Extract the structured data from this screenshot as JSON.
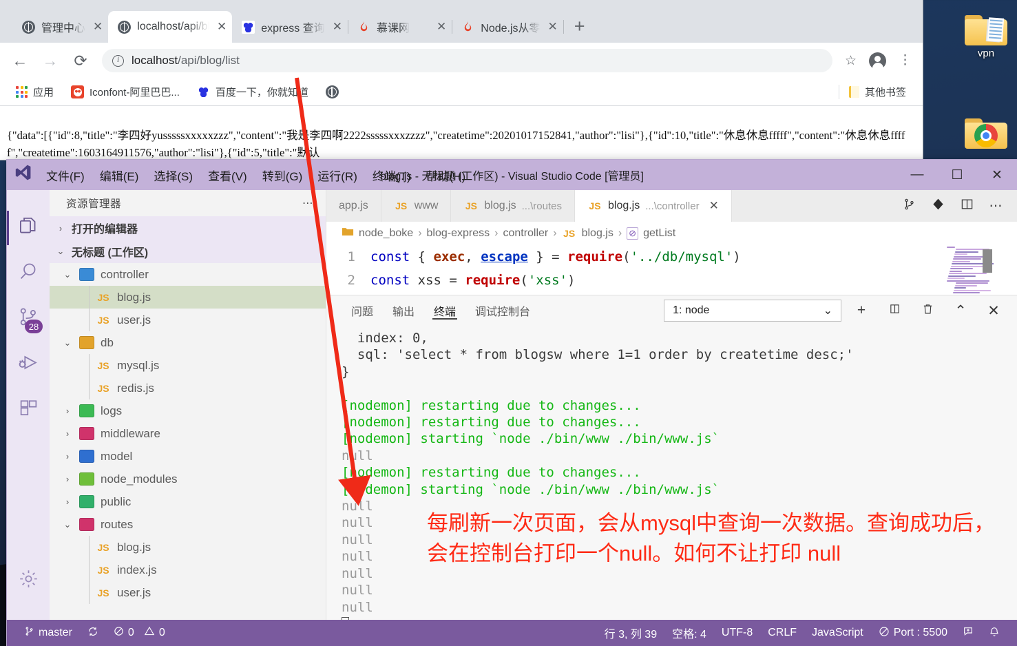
{
  "desktop": {
    "icons": [
      {
        "name": "vpn",
        "label": "vpn",
        "type": "folder"
      },
      {
        "name": "chrome-folder",
        "label": "",
        "type": "chrome-folder"
      }
    ]
  },
  "browser": {
    "tabs": [
      {
        "title": "管理中心",
        "favicon": "globe-icon",
        "active": false
      },
      {
        "title": "localhost/api/blog/list",
        "favicon": "globe-icon",
        "active": true
      },
      {
        "title": "express 查询",
        "favicon": "baidu-icon",
        "active": false
      },
      {
        "title": "慕课网",
        "favicon": "flame-icon",
        "active": false
      },
      {
        "title": "Node.js从零",
        "favicon": "flame-icon",
        "active": false
      }
    ],
    "new_tab_label": "+",
    "close_label": "✕",
    "nav": {
      "back": "←",
      "forward": "→",
      "reload": "⟳"
    },
    "url_prefix": "localhost",
    "url_path": "/api/blog/list",
    "star_label": "☆",
    "menu_label": "⋮",
    "bookmarks": [
      {
        "label": "应用",
        "icon": "apps-grid-icon"
      },
      {
        "label": "Iconfont-阿里巴巴...",
        "icon": "iconfont-icon"
      },
      {
        "label": "百度一下，你就知道",
        "icon": "baidu-icon"
      },
      {
        "label": "",
        "icon": "globe-icon"
      }
    ],
    "other_bookmarks": {
      "label": "其他书签",
      "icon": "folder-icon"
    },
    "page_body": "{\"data\":[{\"id\":8,\"title\":\"李四好yusssssxxxxxzzz\",\"content\":\"我是李四啊2222sssssxxxzzzz\",\"createtime\":20201017152841,\"author\":\"lisi\"},{\"id\":10,\"title\":\"休息休息fffff\",\"content\":\"休息休息fffff\",\"createtime\":1603164911576,\"author\":\"lisi\"},{\"id\":5,\"title\":\"默认"
  },
  "vscode": {
    "logo": "vscode-logo-icon",
    "menus": [
      "文件(F)",
      "编辑(E)",
      "选择(S)",
      "查看(V)",
      "转到(G)",
      "运行(R)",
      "终端(T)",
      "帮助(H)"
    ],
    "title": "blog.js - 无标题 (工作区) - Visual Studio Code [管理员]",
    "window_buttons": {
      "minimize": "—",
      "maximize": "☐",
      "close": "✕"
    },
    "activitybar": [
      {
        "name": "explorer",
        "icon": "files-icon",
        "selected": true,
        "badge": ""
      },
      {
        "name": "search",
        "icon": "search-icon",
        "selected": false,
        "badge": ""
      },
      {
        "name": "source-control",
        "icon": "source-control-icon",
        "selected": false,
        "badge": "28"
      },
      {
        "name": "run-debug",
        "icon": "run-debug-icon",
        "selected": false,
        "badge": ""
      },
      {
        "name": "extensions",
        "icon": "extensions-icon",
        "selected": false,
        "badge": ""
      },
      {
        "name": "settings",
        "icon": "gear-icon",
        "selected": false,
        "badge": ""
      }
    ],
    "sidebar": {
      "title": "资源管理器",
      "more_label": "⋯",
      "sections": [
        {
          "label": "打开的编辑器",
          "expanded": false,
          "chevron": "›"
        },
        {
          "label": "无标题 (工作区)",
          "expanded": true,
          "chevron": "⌄"
        }
      ],
      "tree": [
        {
          "label": "controller",
          "type": "folder",
          "indent": 1,
          "expanded": true,
          "chevron": "⌄",
          "color": "#3a8bd6",
          "selected": false
        },
        {
          "label": "blog.js",
          "type": "js",
          "indent": 2,
          "expanded": null,
          "chevron": "",
          "color": "",
          "selected": true
        },
        {
          "label": "user.js",
          "type": "js",
          "indent": 2,
          "expanded": null,
          "chevron": "",
          "color": "",
          "selected": false
        },
        {
          "label": "db",
          "type": "folder",
          "indent": 1,
          "expanded": true,
          "chevron": "⌄",
          "color": "#e2a32b",
          "selected": false
        },
        {
          "label": "mysql.js",
          "type": "js",
          "indent": 2,
          "expanded": null,
          "chevron": "",
          "color": "",
          "selected": false
        },
        {
          "label": "redis.js",
          "type": "js",
          "indent": 2,
          "expanded": null,
          "chevron": "",
          "color": "",
          "selected": false
        },
        {
          "label": "logs",
          "type": "folder",
          "indent": 1,
          "expanded": false,
          "chevron": "›",
          "color": "#3cba54",
          "selected": false
        },
        {
          "label": "middleware",
          "type": "folder",
          "indent": 1,
          "expanded": false,
          "chevron": "›",
          "color": "#d0336b",
          "selected": false
        },
        {
          "label": "model",
          "type": "folder",
          "indent": 1,
          "expanded": false,
          "chevron": "›",
          "color": "#2f6fd0",
          "selected": false
        },
        {
          "label": "node_modules",
          "type": "folder",
          "indent": 1,
          "expanded": false,
          "chevron": "›",
          "color": "#6fbf3a",
          "selected": false
        },
        {
          "label": "public",
          "type": "folder",
          "indent": 1,
          "expanded": false,
          "chevron": "›",
          "color": "#31b06a",
          "selected": false
        },
        {
          "label": "routes",
          "type": "folder",
          "indent": 1,
          "expanded": true,
          "chevron": "⌄",
          "color": "#d0336b",
          "selected": false
        },
        {
          "label": "blog.js",
          "type": "js",
          "indent": 2,
          "expanded": null,
          "chevron": "",
          "color": "",
          "selected": false
        },
        {
          "label": "index.js",
          "type": "js",
          "indent": 2,
          "expanded": null,
          "chevron": "",
          "color": "",
          "selected": false
        },
        {
          "label": "user.js",
          "type": "js",
          "indent": 2,
          "expanded": null,
          "chevron": "",
          "color": "",
          "selected": false
        }
      ]
    },
    "editor_tabs": [
      {
        "label": "app.js",
        "sub": "",
        "js": false,
        "active": false,
        "close": ""
      },
      {
        "label": "www",
        "sub": "",
        "js": true,
        "active": false,
        "close": ""
      },
      {
        "label": "blog.js",
        "sub": "...\\routes",
        "js": true,
        "active": false,
        "close": ""
      },
      {
        "label": "blog.js",
        "sub": "...\\controller",
        "js": true,
        "active": true,
        "close": "✕"
      }
    ],
    "tab_actions": [
      "split-vertical-icon",
      "source-control-icon",
      "split-editor-icon",
      "more-icon"
    ],
    "breadcrumb": [
      "node_boke",
      "blog-express",
      "controller",
      "blog.js",
      "getList"
    ],
    "breadcrumb_separator": "›",
    "code": {
      "lines": [
        {
          "no": "1",
          "tokens": [
            {
              "t": "const ",
              "c": "k-key"
            },
            {
              "t": "{ ",
              "c": "k-pun"
            },
            {
              "t": "exec",
              "c": "k-var"
            },
            {
              "t": ", ",
              "c": "k-pun"
            },
            {
              "t": "escape",
              "c": "k-link"
            },
            {
              "t": " } = ",
              "c": "k-pun"
            },
            {
              "t": "require",
              "c": "k-fn"
            },
            {
              "t": "(",
              "c": "k-pun"
            },
            {
              "t": "'../db/mysql'",
              "c": "k-str"
            },
            {
              "t": ")",
              "c": "k-pun"
            }
          ]
        },
        {
          "no": "2",
          "tokens": [
            {
              "t": "const ",
              "c": "k-key"
            },
            {
              "t": "xss",
              "c": "k-pun"
            },
            {
              "t": " = ",
              "c": "k-pun"
            },
            {
              "t": "require",
              "c": "k-fn"
            },
            {
              "t": "(",
              "c": "k-pun"
            },
            {
              "t": "'xss'",
              "c": "k-str"
            },
            {
              "t": ")",
              "c": "k-pun"
            }
          ]
        }
      ]
    },
    "panel": {
      "tabs": [
        {
          "label": "问题",
          "active": false
        },
        {
          "label": "输出",
          "active": false
        },
        {
          "label": "终端",
          "active": true
        },
        {
          "label": "调试控制台",
          "active": false
        }
      ],
      "terminal_select": "1: node",
      "terminal_select_chevron": "⌄",
      "actions": [
        "add-terminal-icon",
        "split-terminal-icon",
        "kill-terminal-icon",
        "chevron-up-icon",
        "close-panel-icon"
      ],
      "terminal_lines": [
        {
          "t": "  index: 0,",
          "c": ""
        },
        {
          "t": "  sql: 'select * from blogsw where 1=1 order by createtime desc;'",
          "c": ""
        },
        {
          "t": "}",
          "c": ""
        },
        {
          "t": "",
          "c": ""
        },
        {
          "t": "[nodemon] restarting due to changes...",
          "c": "t-green"
        },
        {
          "t": "[nodemon] restarting due to changes...",
          "c": "t-green"
        },
        {
          "t": "[nodemon] starting `node ./bin/www ./bin/www.js`",
          "c": "t-green"
        },
        {
          "t": "null",
          "c": "t-grey"
        },
        {
          "t": "[nodemon] restarting due to changes...",
          "c": "t-green"
        },
        {
          "t": "[nodemon] starting `node ./bin/www ./bin/www.js`",
          "c": "t-green"
        },
        {
          "t": "null",
          "c": "t-grey"
        },
        {
          "t": "null",
          "c": "t-grey"
        },
        {
          "t": "null",
          "c": "t-grey"
        },
        {
          "t": "null",
          "c": "t-grey"
        },
        {
          "t": "null",
          "c": "t-grey"
        },
        {
          "t": "null",
          "c": "t-grey"
        },
        {
          "t": "null",
          "c": "t-grey"
        }
      ]
    },
    "statusbar": {
      "left": [
        {
          "label": "master",
          "icon": "git-branch-icon"
        },
        {
          "label": "",
          "icon": "sync-icon"
        },
        {
          "label": "0",
          "icon": "error-icon"
        },
        {
          "label": "0",
          "icon": "warning-icon"
        }
      ],
      "right": [
        {
          "label": "行 3, 列 39",
          "icon": ""
        },
        {
          "label": "空格: 4",
          "icon": ""
        },
        {
          "label": "UTF-8",
          "icon": ""
        },
        {
          "label": "CRLF",
          "icon": ""
        },
        {
          "label": "JavaScript",
          "icon": ""
        },
        {
          "label": "Port : 5500",
          "icon": "go-live-icon"
        },
        {
          "label": "",
          "icon": "feedback-icon"
        },
        {
          "label": "",
          "icon": "bell-icon"
        }
      ]
    }
  },
  "annotation": {
    "text": "每刷新一次页面，会从mysql中查询一次数据。查询成功后，会在控制台打印一个null。如何不让打印 null",
    "color": "#fe2b16",
    "arrow_color": "#ef2a18"
  }
}
